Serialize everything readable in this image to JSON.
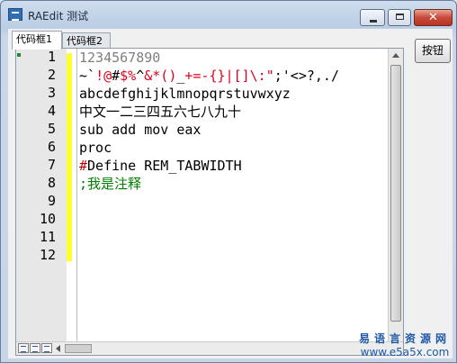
{
  "window": {
    "title": "RAEdit 测试",
    "close_glyph": "✕"
  },
  "tabs": [
    {
      "label": "代码框1",
      "active": true
    },
    {
      "label": "代码框2",
      "active": false
    }
  ],
  "side_button": {
    "label": "按钮"
  },
  "editor": {
    "line_numbers": [
      "1",
      "2",
      "3",
      "4",
      "5",
      "6",
      "7",
      "8",
      "9",
      "10",
      "11",
      "12"
    ],
    "lines": [
      {
        "segments": [
          {
            "text": "1234567890",
            "color": "#7f7f7f"
          }
        ]
      },
      {
        "segments": [
          {
            "text": "~`",
            "color": "#000000"
          },
          {
            "text": "!@",
            "color": "#e0001b"
          },
          {
            "text": "#",
            "color": "#000000"
          },
          {
            "text": "$%",
            "color": "#e0001b"
          },
          {
            "text": "^",
            "color": "#000000"
          },
          {
            "text": "&*()",
            "color": "#e0001b"
          },
          {
            "text": "_",
            "color": "#000000"
          },
          {
            "text": "+=-{}|[]\\:\"",
            "color": "#e0001b"
          },
          {
            "text": ";'<>?,./",
            "color": "#000000"
          }
        ]
      },
      {
        "segments": [
          {
            "text": "abcdefghijklmnopqrstuvwxyz",
            "color": "#000000"
          }
        ]
      },
      {
        "segments": [
          {
            "text": "中文一二三四五六七八九十",
            "color": "#000000"
          }
        ]
      },
      {
        "segments": [
          {
            "text": "sub add mov eax",
            "color": "#000000"
          }
        ]
      },
      {
        "segments": [
          {
            "text": "proc",
            "color": "#000000"
          }
        ]
      },
      {
        "segments": [
          {
            "text": "#",
            "color": "#c00000"
          },
          {
            "text": "Define REM_TABWIDTH",
            "color": "#000000"
          }
        ]
      },
      {
        "segments": [
          {
            "text": ";我是注释",
            "color": "#008000"
          }
        ]
      }
    ]
  },
  "watermark": {
    "chinese": "易语言资源网",
    "url": "www.e5a5x.com"
  },
  "colors": {
    "bookmark_bar": "#ffff30",
    "gutter": "#e7e7e7"
  }
}
